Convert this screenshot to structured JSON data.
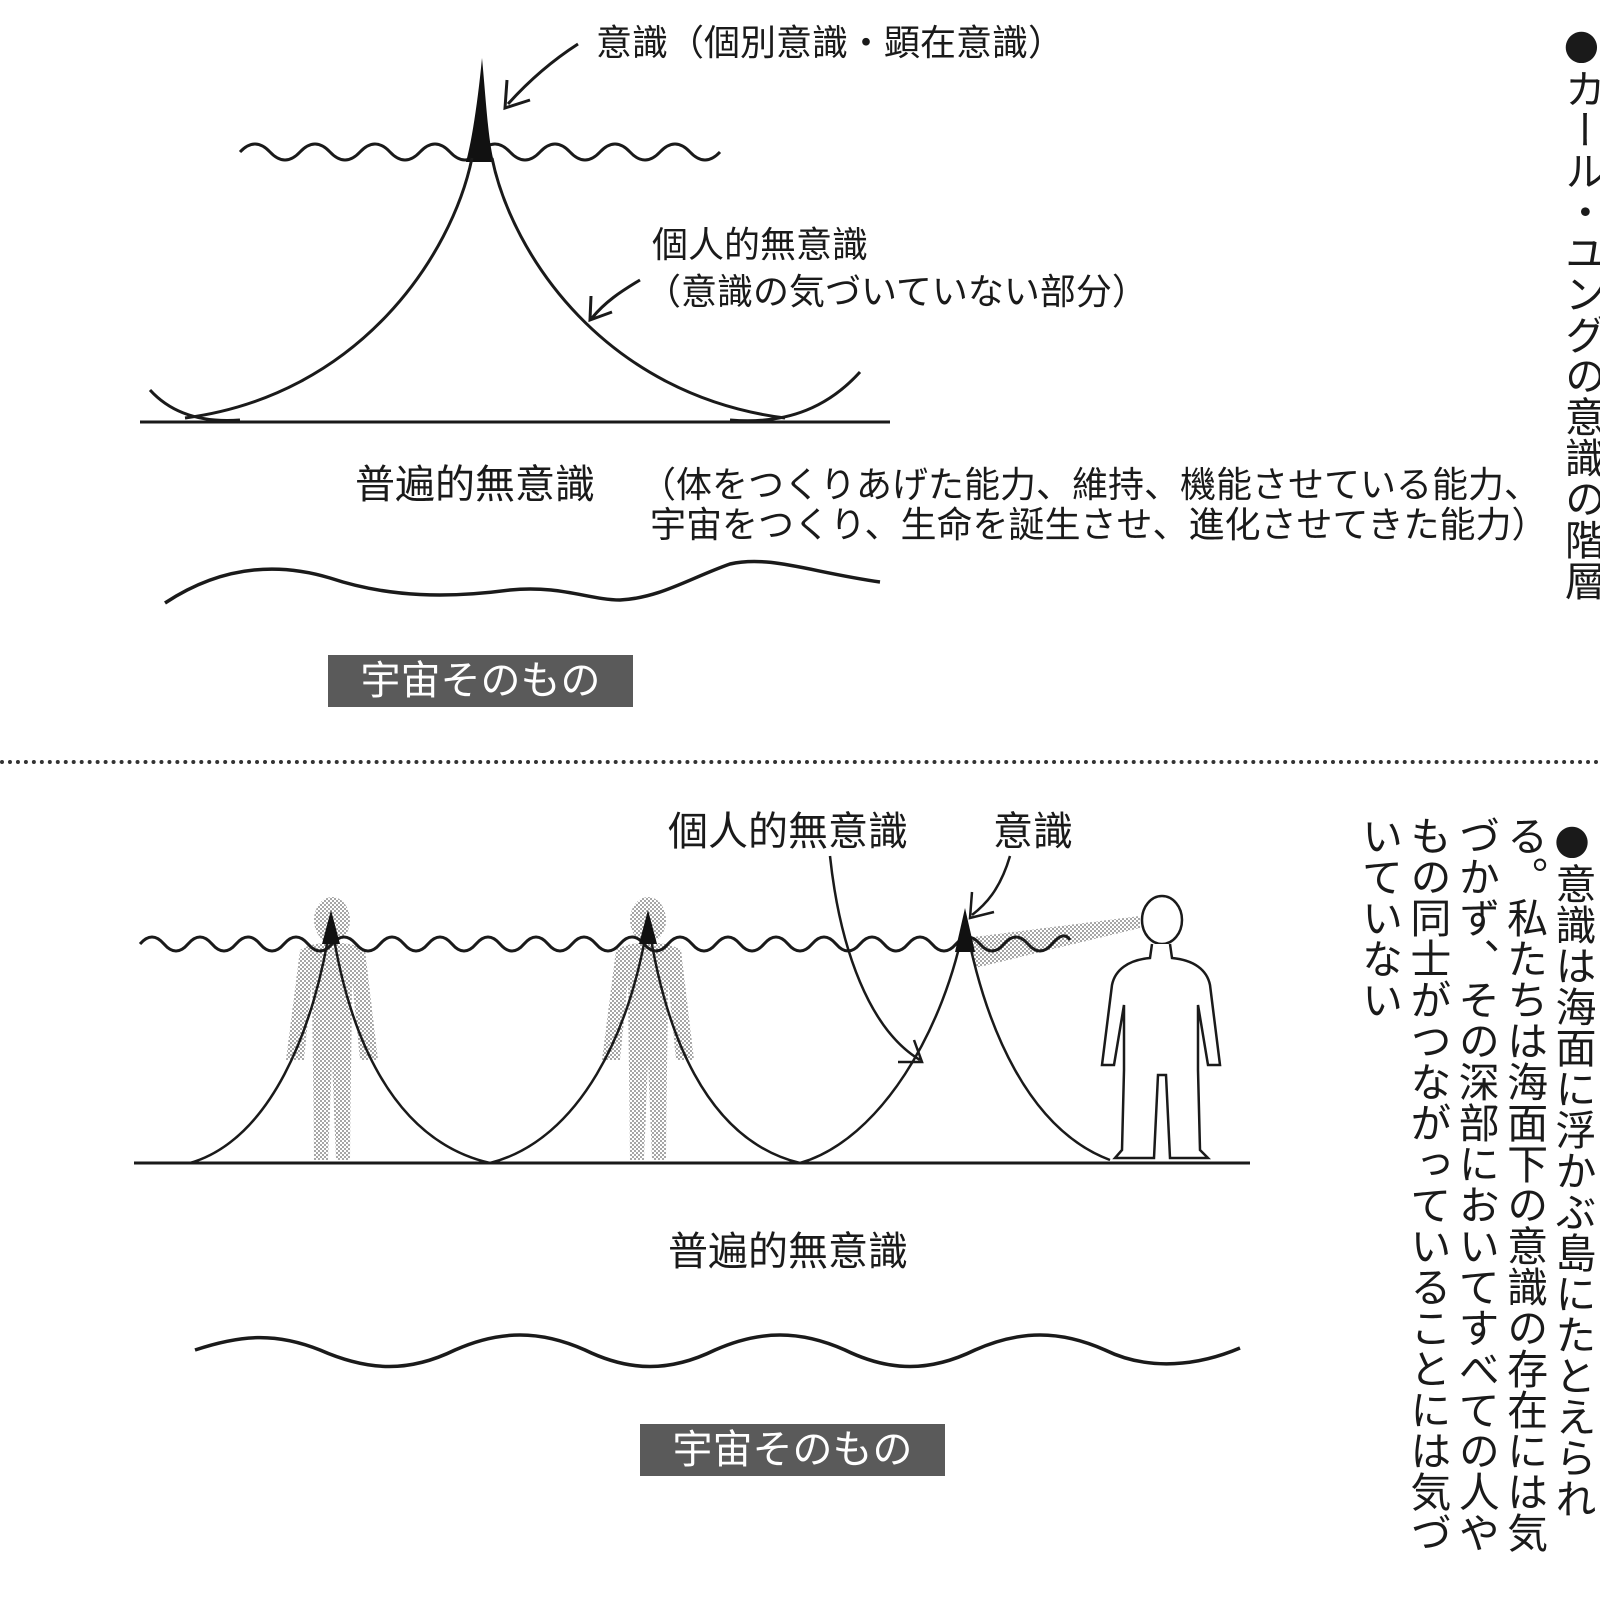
{
  "top_diagram": {
    "consciousness_label": "意識（個別意識・顕在意識）",
    "personal_unconscious_title": "個人的無意識",
    "personal_unconscious_note": "（意識の気づいていない部分）",
    "collective_unconscious_label": "普遍的無意識",
    "collective_note_line1": "（体をつくりあげた能力、維持、機能させている能力、",
    "collective_note_line2": "宇宙をつくり、生命を誕生させ、進化させてきた能力）",
    "universe_label": "宇宙そのもの"
  },
  "side_title": "●カール・ユングの意識の階層",
  "bottom_diagram": {
    "personal_unconscious_label": "個人的無意識",
    "consciousness_label": "意識",
    "collective_unconscious_label": "普遍的無意識",
    "universe_label": "宇宙そのもの"
  },
  "side_note": "●意識は海面に浮かぶ島にたとえられる。私たちは海面下の意識の存在には気づかず、その深部においてすべての人やもの同士がつながっていることには気づいていない",
  "colors": {
    "ink": "#1a1a1a",
    "box": "#5a5a5a",
    "shade": "#b4b4b4",
    "box_text": "#ffffff"
  }
}
